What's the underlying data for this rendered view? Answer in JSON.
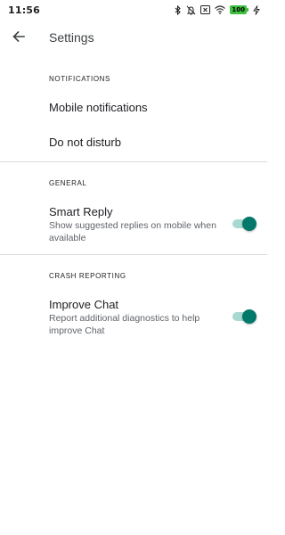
{
  "status_bar": {
    "time": "11:56",
    "icons": [
      "bluetooth-icon",
      "notifications-off-icon",
      "close-box-icon",
      "wifi-icon"
    ],
    "battery_level": "100",
    "battery_color": "#3fbf3f"
  },
  "app_bar": {
    "back_icon": "arrow-back-icon",
    "title": "Settings"
  },
  "sections": {
    "notifications": {
      "header": "NOTIFICATIONS",
      "items": [
        {
          "title": "Mobile notifications"
        },
        {
          "title": "Do not disturb"
        }
      ]
    },
    "general": {
      "header": "GENERAL",
      "smart_reply": {
        "title": "Smart Reply",
        "summary": "Show suggested replies on mobile when available",
        "enabled": true
      }
    },
    "crash_reporting": {
      "header": "CRASH REPORTING",
      "improve_chat": {
        "title": "Improve Chat",
        "summary": "Report additional diagnostics to help improve Chat",
        "enabled": true
      }
    }
  },
  "colors": {
    "accent": "#00796b",
    "toggle_track": "#a8d9d1",
    "divider": "#dadce0",
    "secondary_text": "#5f6368"
  }
}
